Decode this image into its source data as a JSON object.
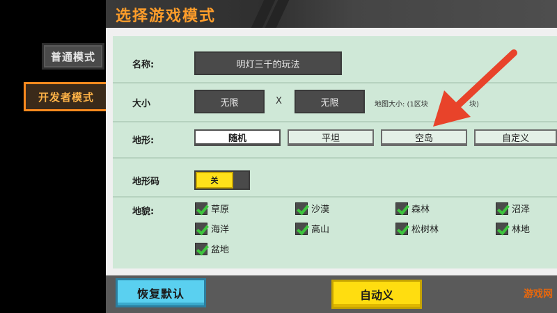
{
  "modes": {
    "normal_label": "普通模式",
    "developer_label": "开发者模式"
  },
  "dialog": {
    "title": "选择游戏模式"
  },
  "form": {
    "name_label": "名称:",
    "name_value": "明灯三千的玩法",
    "size_label": "大小",
    "width_value": "无限",
    "size_separator": "X",
    "height_value": "无限",
    "size_hint": "地图大小: (1区块",
    "size_hint_tail": "块)",
    "terrain_label": "地形:",
    "terrain_options": [
      "随机",
      "平坦",
      "空岛",
      "自定义"
    ],
    "terrain_selected": "随机",
    "terrain_code_label": "地形码",
    "terrain_code_toggle": "关",
    "biome_label": "地貌:",
    "biomes": [
      "草原",
      "沙漠",
      "森林",
      "沼泽",
      "海洋",
      "高山",
      "松树林",
      "林地",
      "盆地"
    ]
  },
  "actions": {
    "restore_label": "恢复默认",
    "confirm_label": "自动义"
  },
  "watermark": "游戏网",
  "colors": {
    "accent": "#ff9d2a",
    "panel": "#cfe8d7",
    "check": "#3ec43e",
    "arrow": "#e8432a"
  }
}
